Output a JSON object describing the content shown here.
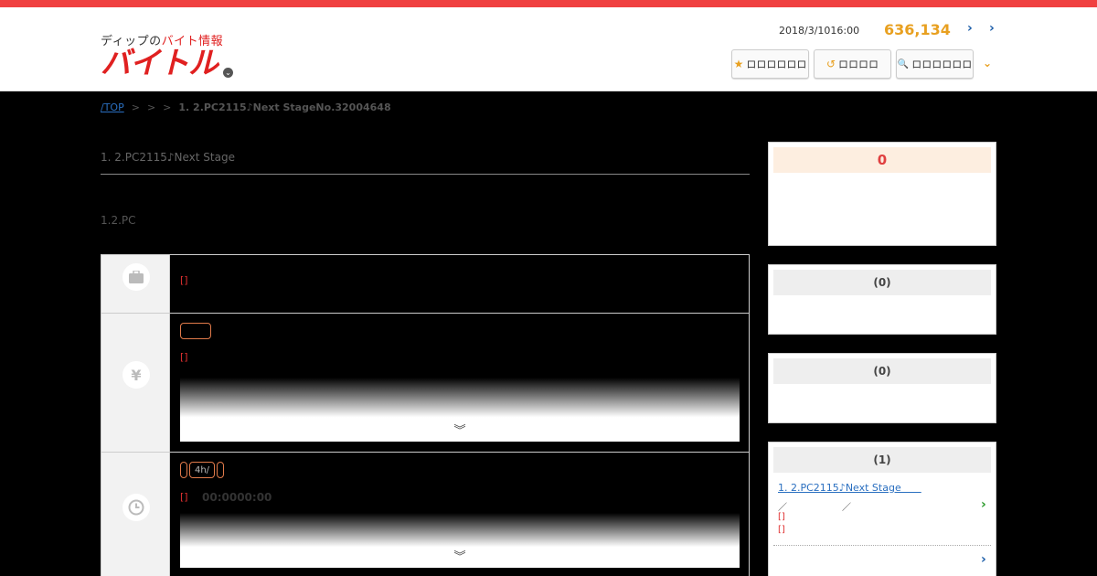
{
  "header": {
    "logo_sub_prefix": "ディップの",
    "logo_sub_red": "バイト情報",
    "logo_main": "バイトル",
    "date": "2018/3/1016:00",
    "job_count": "636,134",
    "link_1": "›",
    "link_2": "›",
    "buttons": [
      {
        "icon": "★",
        "label": "ロロロロロロ"
      },
      {
        "icon": "↺",
        "label": "ロロロロ"
      },
      {
        "icon": "🔍",
        "label": "ロロロロロロ"
      }
    ],
    "more_chevron": "⌄"
  },
  "breadcrumb": {
    "home": "/TOP",
    "sep1": ">",
    "sep2": ">",
    "sep3": ">",
    "current": "1. 2.PC2115♪Next StageNo.32004648"
  },
  "job": {
    "title": "1. 2.PC2115♪Next Stage",
    "category": "1.2.PC"
  },
  "rows": {
    "work": {
      "text": "[]"
    },
    "pay": {
      "text": "[]",
      "more": "︾"
    },
    "hours": {
      "tag": "4h/",
      "text": "[]",
      "time": "00:0000:00",
      "more": "︾"
    }
  },
  "sidebar": {
    "box1": {
      "title": "0"
    },
    "box2": {
      "title": "(0)"
    },
    "box3": {
      "title": "(0)"
    },
    "box4": {
      "title": "(1)",
      "job_link": "1. 2.PC2115♪Next Stage　　",
      "meta_line": "／　　　　　　／",
      "line2": "[]",
      "line3": "[]",
      "chev": "›",
      "chev_bottom": "›"
    }
  },
  "colors": {
    "brand_red": "#e02020",
    "accent_orange": "#e8a020",
    "link_blue": "#2a6fc0"
  }
}
